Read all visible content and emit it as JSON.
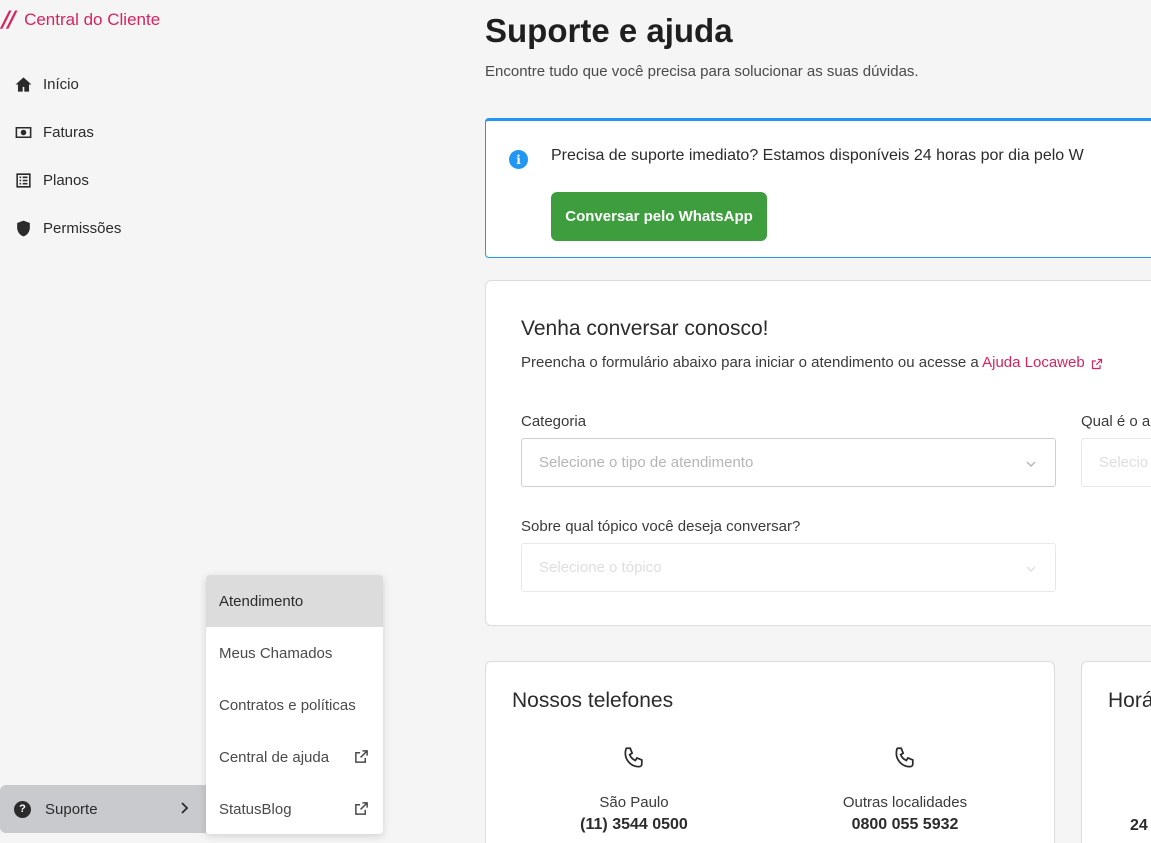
{
  "brand": {
    "logo": "//",
    "title": "Central do Cliente",
    "color": "#d6245f"
  },
  "nav": {
    "items": [
      {
        "label": "Início",
        "icon": "home-icon"
      },
      {
        "label": "Faturas",
        "icon": "invoice-icon"
      },
      {
        "label": "Planos",
        "icon": "list-icon"
      },
      {
        "label": "Permissões",
        "icon": "shield-icon"
      }
    ],
    "support": {
      "label": "Suporte",
      "icon": "help-circle-icon",
      "badge": "?"
    }
  },
  "submenu": {
    "items": [
      {
        "label": "Atendimento",
        "active": true
      },
      {
        "label": "Meus Chamados"
      },
      {
        "label": "Contratos e políticas"
      },
      {
        "label": "Central de ajuda",
        "external": true
      },
      {
        "label": "StatusBlog",
        "external": true
      }
    ]
  },
  "main": {
    "title": "Suporte e ajuda",
    "subtitle": "Encontre tudo que você precisa para solucionar as suas dúvidas."
  },
  "alert": {
    "icon_text": "i",
    "message": "Precisa de suporte imediato? Estamos disponíveis 24 horas por dia pelo W",
    "button_label": "Conversar pelo WhatsApp",
    "accent": "#2196f3",
    "button_color": "#3e9e3e"
  },
  "contact_form": {
    "title": "Venha conversar conosco!",
    "description": "Preencha o formulário abaixo para iniciar o atendimento ou acesse a ",
    "link_label": "Ajuda Locaweb",
    "category_label": "Categoria",
    "category_placeholder": "Selecione o tipo de atendimento",
    "second_label": "Qual é o a",
    "second_placeholder": "Selecio",
    "topic_label": "Sobre qual tópico você deseja conversar?",
    "topic_placeholder": "Selecione o tópico"
  },
  "phones": {
    "title": "Nossos telefones",
    "entries": [
      {
        "location": "São Paulo",
        "number": "(11) 3544 0500"
      },
      {
        "location": "Outras localidades",
        "number": "0800 055 5932"
      }
    ]
  },
  "hours": {
    "title": "Horá",
    "value": "24"
  }
}
